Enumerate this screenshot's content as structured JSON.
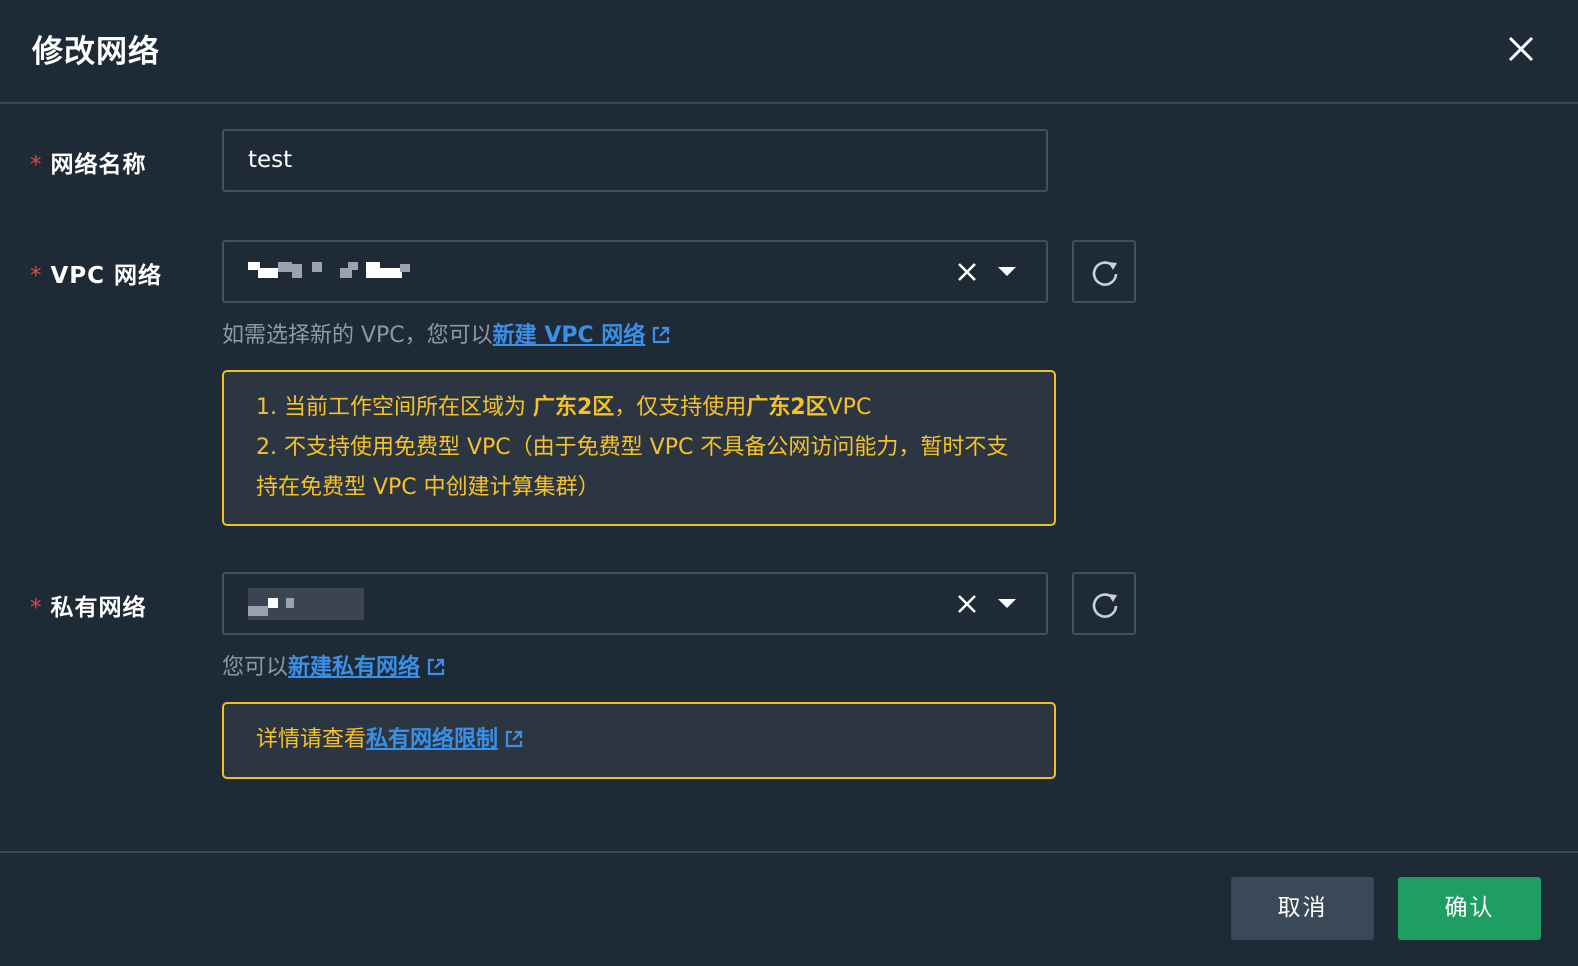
{
  "dialog": {
    "title": "修改网络"
  },
  "fields": {
    "network_name": {
      "required_mark": "*",
      "label": "网络名称",
      "value": "test"
    },
    "vpc": {
      "required_mark": "*",
      "label": "VPC 网络",
      "hint_prefix": "如需选择新的 VPC，您可以",
      "hint_link": "新建 VPC 网络",
      "notice": {
        "line1_prefix": "1. 当前工作空间所在区域为 ",
        "line1_region": "广东2区",
        "line1_middle": "，仅支持使用",
        "line1_region2": "广东2区",
        "line1_suffix": "VPC",
        "line2": "2. 不支持使用免费型 VPC（由于免费型 VPC 不具备公网访问能力，暂时不支持在免费型 VPC 中创建计算集群）"
      }
    },
    "private_network": {
      "required_mark": "*",
      "label": "私有网络",
      "hint_prefix": "您可以",
      "hint_link": "新建私有网络",
      "notice_prefix": "详情请查看",
      "notice_link": "私有网络限制"
    }
  },
  "footer": {
    "cancel_label": "取消",
    "confirm_label": "确认"
  },
  "icons": {
    "close": "close-icon",
    "clear": "clear-icon",
    "caret": "caret-down-icon",
    "refresh": "refresh-icon",
    "external": "external-link-icon"
  },
  "colors": {
    "background": "#1f2a37",
    "required": "#e54545",
    "link": "#3a8fe6",
    "warning": "#f5c22a",
    "primary": "#1f9e63"
  }
}
